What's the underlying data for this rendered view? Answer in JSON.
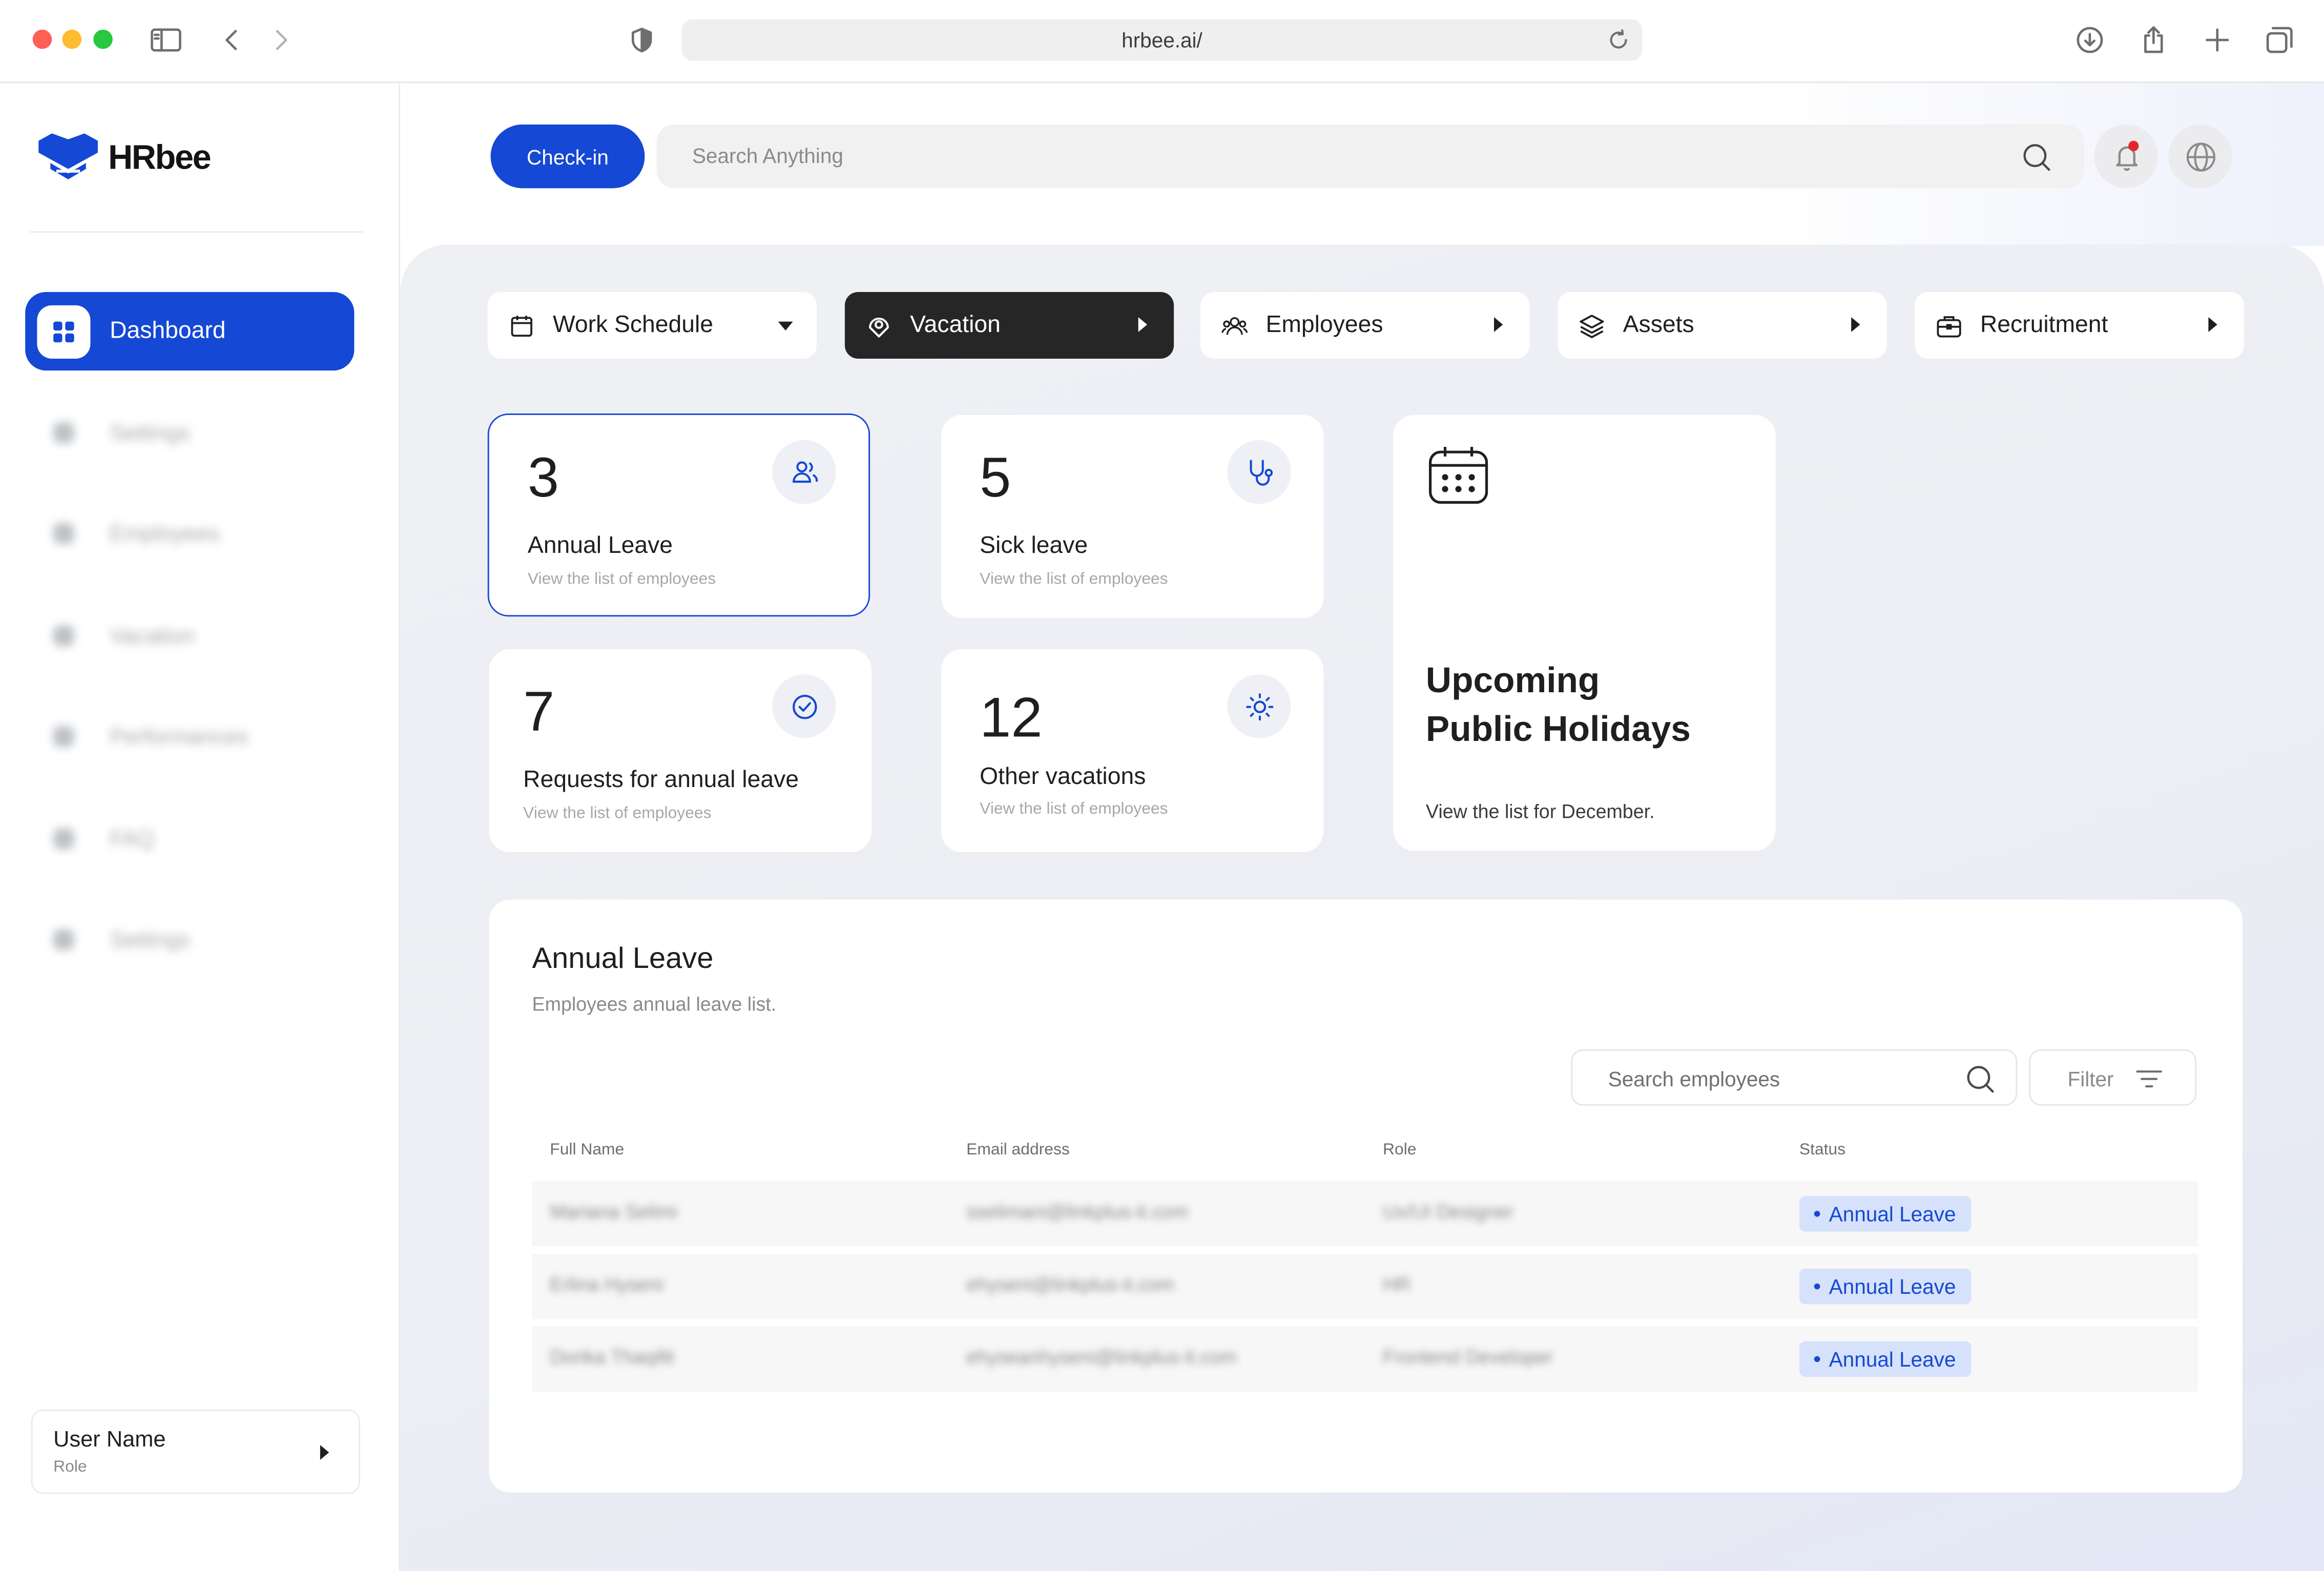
{
  "browser": {
    "url": "hrbee.ai/"
  },
  "sidebar": {
    "logo_text": "HRbee",
    "active_item": "Dashboard",
    "items": [
      {
        "label": "Settings"
      },
      {
        "label": "Employees"
      },
      {
        "label": "Vacation"
      },
      {
        "label": "Performances"
      },
      {
        "label": "FAQ"
      },
      {
        "label": "Settings"
      }
    ],
    "user": {
      "name": "User Name",
      "role": "Role"
    }
  },
  "topbar": {
    "checkin_label": "Check-in",
    "search_placeholder": "Search Anything"
  },
  "tabs": [
    {
      "label": "Work Schedule",
      "icon": "calendar-icon"
    },
    {
      "label": "Vacation",
      "icon": "beach-icon"
    },
    {
      "label": "Employees",
      "icon": "users-icon"
    },
    {
      "label": "Assets",
      "icon": "layers-icon"
    },
    {
      "label": "Recruitment",
      "icon": "briefcase-icon"
    }
  ],
  "stats": [
    {
      "value": "3",
      "title": "Annual Leave",
      "sub": "View the list of employees",
      "icon": "users-icon"
    },
    {
      "value": "5",
      "title": "Sick leave",
      "sub": "View the list of employees",
      "icon": "stethoscope-icon"
    },
    {
      "value": "7",
      "title": "Requests for annual leave",
      "sub": "View the list of employees",
      "icon": "check-circle-icon"
    },
    {
      "value": "12",
      "title": "Other vacations",
      "sub": "View the list of employees",
      "icon": "sun-icon"
    }
  ],
  "holidays": {
    "title_line1": "Upcoming",
    "title_line2": "Public Holidays",
    "sub": "View the list for December."
  },
  "annual_leave_table": {
    "title": "Annual Leave",
    "subtitle": "Employees annual leave list.",
    "search_placeholder": "Search employees",
    "filter_label": "Filter",
    "columns": [
      "Full Name",
      "Email address",
      "Role",
      "Status"
    ],
    "rows": [
      {
        "name": "Mariana Selimi",
        "email": "sselimani@linkplus-it.com",
        "role": "Ux/UI Designer",
        "status": "Annual Leave"
      },
      {
        "name": "Erlina Hyseni",
        "email": "ehyseni@linkplus-it.com",
        "role": "HR",
        "status": "Annual Leave"
      },
      {
        "name": "Dorika Thaqifé",
        "email": "ehyseanhyseni@linkplus-it.com",
        "role": "Frontend Developer",
        "status": "Annual Leave"
      }
    ]
  },
  "colors": {
    "accent": "#1548d4",
    "dark_tab": "#262626",
    "status_bg": "#d6e2fb"
  }
}
